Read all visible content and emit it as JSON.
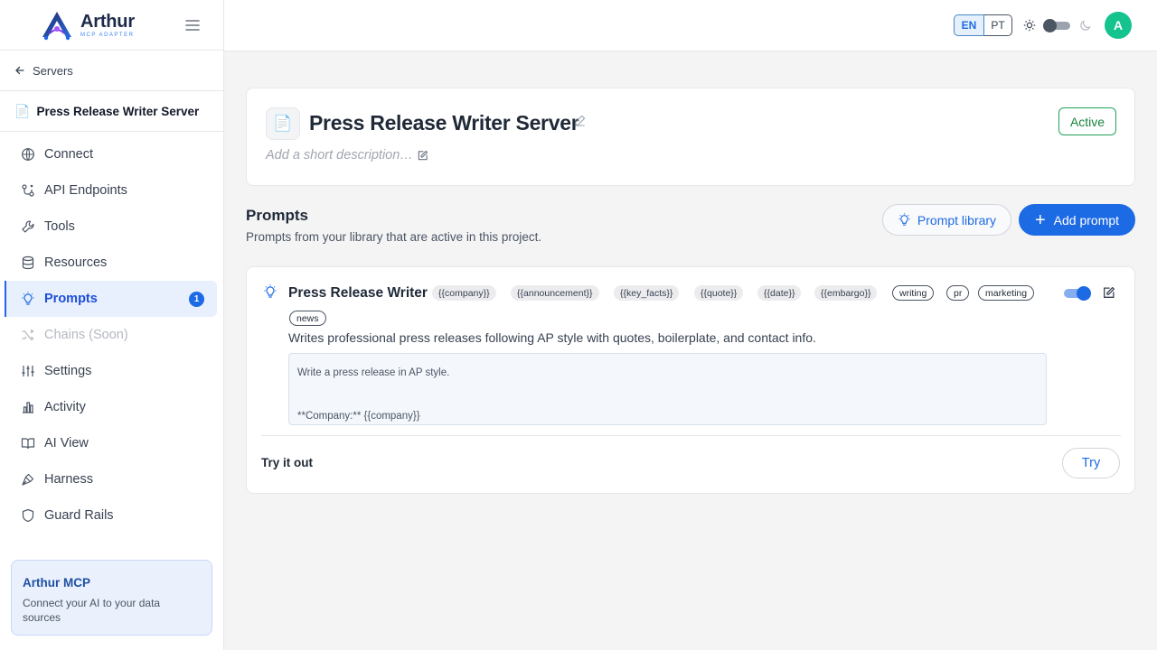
{
  "brand": {
    "name": "Arthur",
    "subtitle": "MCP ADAPTER"
  },
  "sidebar": {
    "back_label": "Servers",
    "server_icon": "📄",
    "server_name": "Press Release Writer Server",
    "items": [
      {
        "label": "Connect",
        "icon": "globe-icon"
      },
      {
        "label": "API Endpoints",
        "icon": "api-icon"
      },
      {
        "label": "Tools",
        "icon": "wrench-icon"
      },
      {
        "label": "Resources",
        "icon": "database-icon"
      },
      {
        "label": "Prompts",
        "icon": "lightbulb-icon",
        "active": true,
        "badge": "1"
      },
      {
        "label": "Chains (Soon)",
        "icon": "shuffle-icon",
        "disabled": true
      },
      {
        "label": "Settings",
        "icon": "sliders-icon"
      },
      {
        "label": "Activity",
        "icon": "bar-chart-icon"
      },
      {
        "label": "AI View",
        "icon": "book-icon"
      },
      {
        "label": "Harness",
        "icon": "pen-tool-icon"
      },
      {
        "label": "Guard Rails",
        "icon": "shield-icon"
      }
    ],
    "promo": {
      "title": "Arthur MCP",
      "text": "Connect your AI to your data sources"
    }
  },
  "topbar": {
    "lang_en": "EN",
    "lang_pt": "PT",
    "avatar_initial": "A"
  },
  "server": {
    "icon": "📄",
    "title": "Press Release Writer Server",
    "description_placeholder": "Add a short description…",
    "status": "Active"
  },
  "prompts_section": {
    "title": "Prompts",
    "subtitle": "Prompts from your library that are active in this project.",
    "library_button": "Prompt library",
    "add_button": "Add prompt"
  },
  "prompt": {
    "name": "Press Release Writer",
    "variables": [
      "{{company}}",
      "{{announcement}}",
      "{{key_facts}}",
      "{{quote}}",
      "{{date}}",
      "{{embargo}}"
    ],
    "keywords": [
      "writing",
      "pr",
      "marketing",
      "news"
    ],
    "description": "Writes professional press releases following AP style with quotes, boilerplate, and contact info.",
    "body_line1": "Write a press release in AP style.",
    "body_line3": "**Company:** {{company}}",
    "enabled": true,
    "try_label": "Try it out",
    "try_button": "Try"
  },
  "colors": {
    "accent": "#1d6ae5",
    "status_green": "#16863f",
    "avatar": "#14c38e"
  }
}
